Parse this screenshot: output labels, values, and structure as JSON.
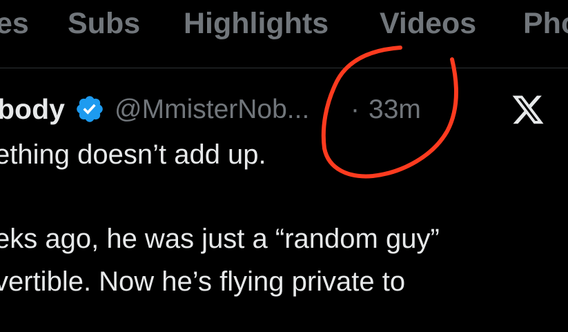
{
  "tabs": [
    {
      "label": "es"
    },
    {
      "label": "Subs"
    },
    {
      "label": "Highlights"
    },
    {
      "label": "Videos"
    },
    {
      "label": "Pho"
    }
  ],
  "tweet": {
    "display_name": "body",
    "handle": "@MmisterNob...",
    "separator": "·",
    "time": "33m",
    "lines": [
      "ething doesn’t add up.",
      "",
      "eks ago, he was just a “random guy”",
      "vertible. Now he’s flying private to"
    ]
  },
  "colors": {
    "background": "#000000",
    "tab_text": "#71767b",
    "primary_text": "#e7e9ea",
    "secondary_text": "#71767b",
    "verified_badge": "#1d9bf0",
    "annotation_stroke": "#ff3b1f"
  },
  "icons": {
    "verified": "verified-badge-icon",
    "platform": "x-logo-icon"
  }
}
